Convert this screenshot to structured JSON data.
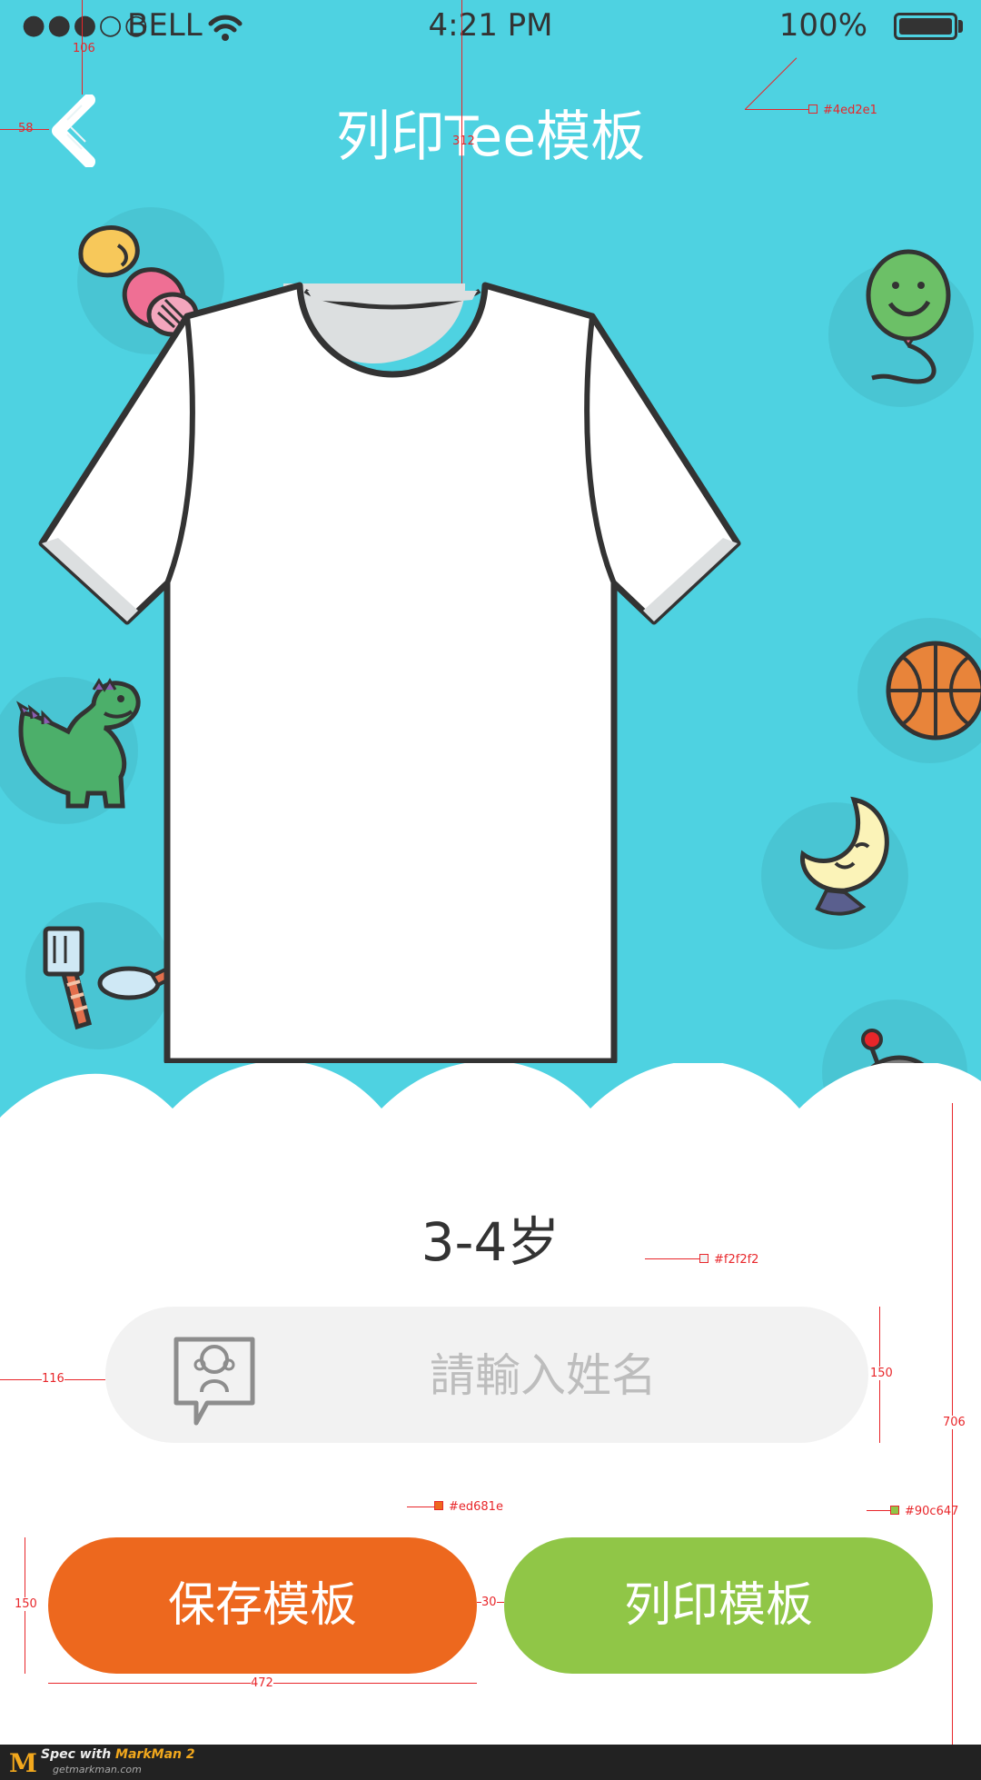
{
  "status_bar": {
    "signal": "●●●○○",
    "carrier": "BELL",
    "time": "4:21 PM",
    "battery": "100%"
  },
  "nav": {
    "title": "列印Tee模板"
  },
  "product": {
    "age_label": "3-4岁"
  },
  "form": {
    "name_placeholder": "請輸入姓名",
    "name_value": ""
  },
  "actions": {
    "save_label": "保存模板",
    "print_label": "列印模板"
  },
  "footer": {
    "logo": "M",
    "prefix": "Spec with ",
    "brand": "MarkMan 2",
    "site": "getmarkman.com"
  },
  "spec": {
    "nav_top": "106",
    "nav_left": "58",
    "title_to_shirt": "312",
    "bg_color": "#4ed2e1",
    "field_color": "#f2f2f2",
    "field_left": "116",
    "field_height": "150",
    "white_height": "706",
    "save_color": "#ed681e",
    "print_color": "#90c647",
    "button_height": "150",
    "button_gap": "30",
    "button_width": "472"
  },
  "colors": {
    "background": "#4ed2e1",
    "field": "#f2f2f2",
    "save": "#ed681e",
    "print": "#90c647"
  }
}
